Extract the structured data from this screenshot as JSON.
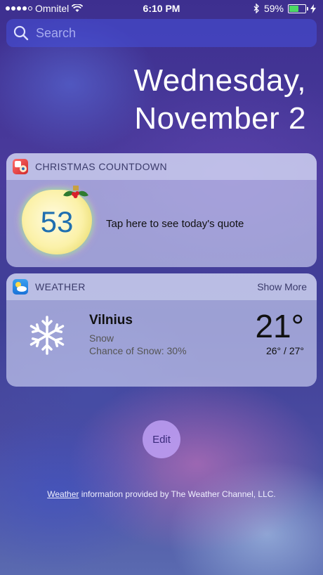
{
  "status_bar": {
    "carrier": "Omnitel",
    "time": "6:10 PM",
    "battery": "59%",
    "battery_fraction": 0.59
  },
  "search": {
    "placeholder": "Search"
  },
  "date": {
    "weekday": "Wednesday,",
    "day": "November 2"
  },
  "countdown_widget": {
    "title": "CHRISTMAS COUNTDOWN",
    "days": "53",
    "quote_prompt": "Tap here to see today's quote"
  },
  "weather_widget": {
    "title": "WEATHER",
    "show_more": "Show More",
    "city": "Vilnius",
    "condition": "Snow",
    "chance": "Chance of Snow: 30%",
    "temperature": "21°",
    "range": "26° / 27°"
  },
  "edit_label": "Edit",
  "footer": {
    "link": "Weather",
    "text": " information provided by The Weather Channel, LLC."
  }
}
